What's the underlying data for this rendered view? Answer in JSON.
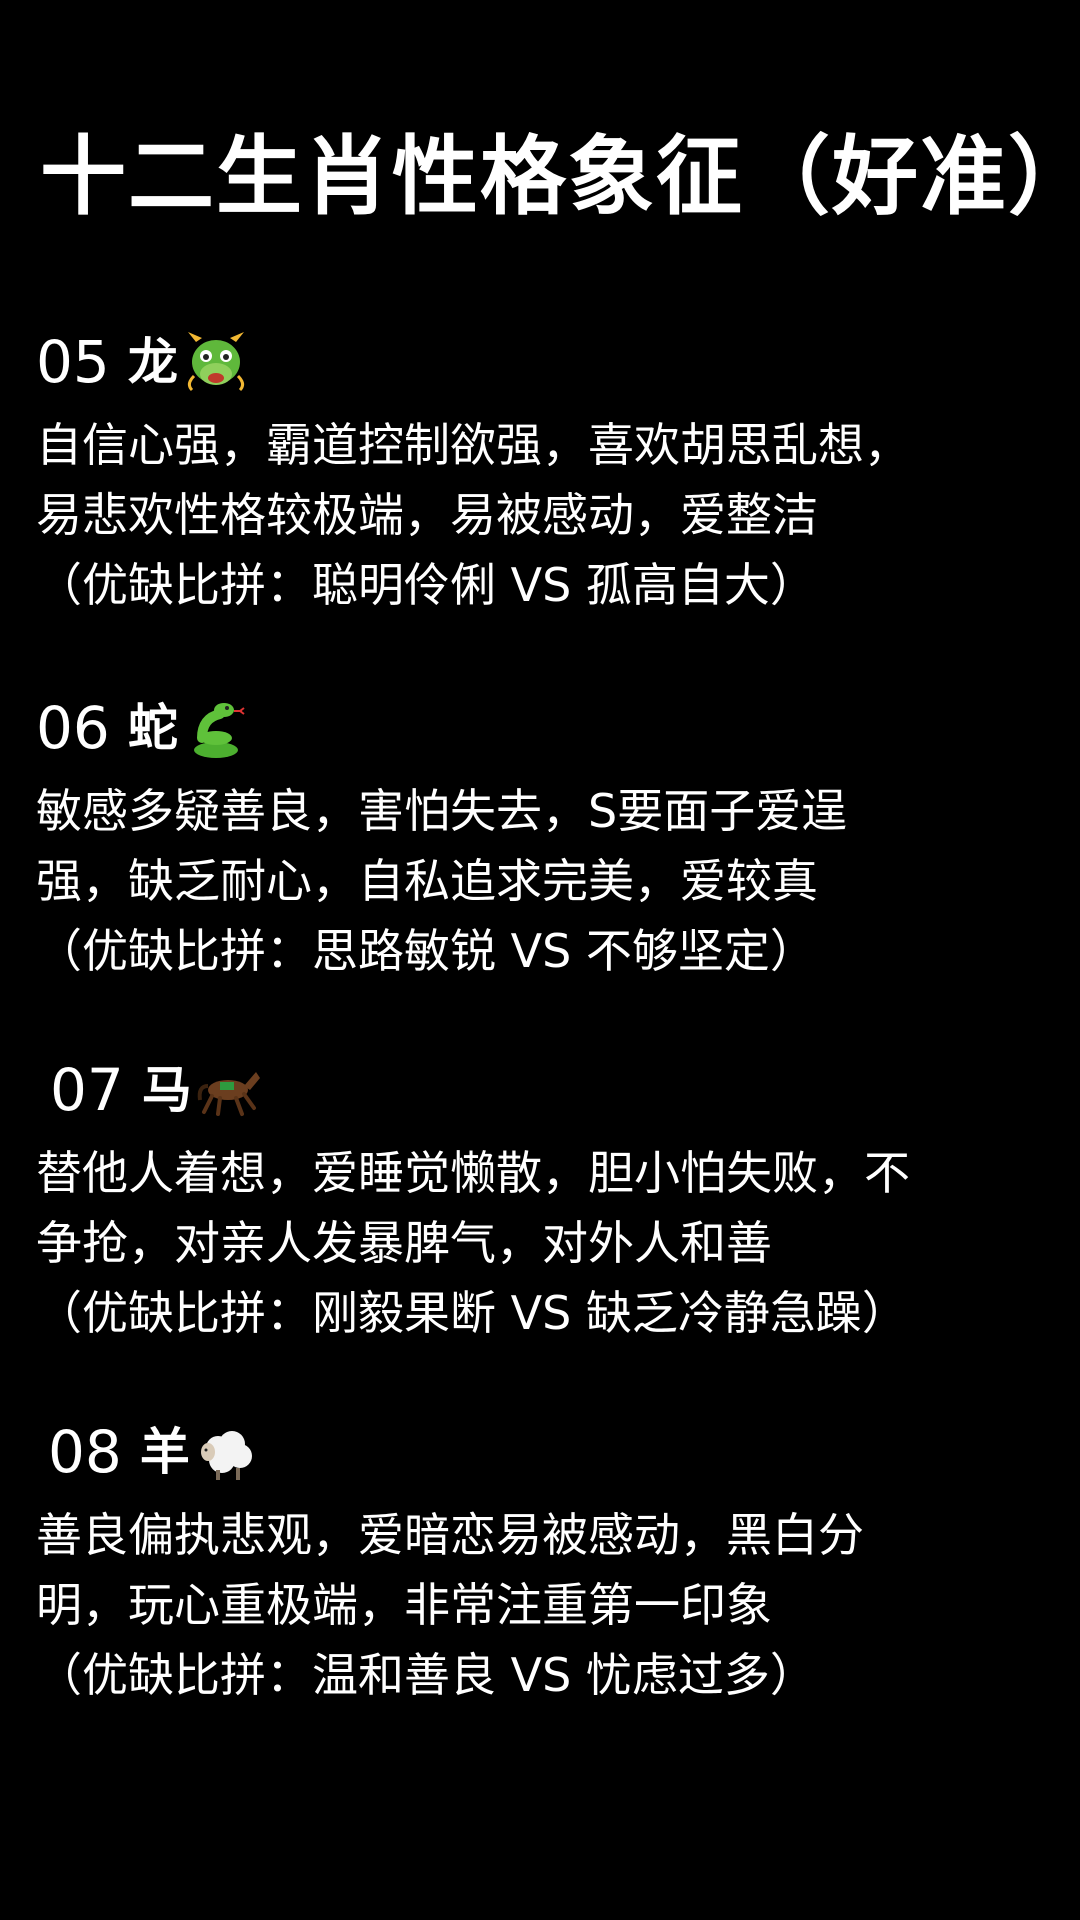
{
  "title": "十二生肖性格象征（好准）",
  "entries": [
    {
      "num": "05",
      "animal": "龙",
      "icon": "dragon-face-icon",
      "lines": [
        "自信心强，霸道控制欲强，喜欢胡思乱想，",
        "易悲欢性格较极端，易被感动，爱整洁"
      ],
      "merit": "（优缺比拼：聪明伶俐 VS 孤高自大）"
    },
    {
      "num": "06",
      "animal": "蛇",
      "icon": "snake-icon",
      "lines": [
        "敏感多疑善良，害怕失去，S要面子爱逞",
        "强，缺乏耐心，自私追求完美，爱较真"
      ],
      "merit": "（优缺比拼：思路敏锐 VS 不够坚定）"
    },
    {
      "num": "07",
      "animal": "马",
      "icon": "racehorse-icon",
      "lines": [
        "替他人着想，爱睡觉懒散，胆小怕失败，不",
        "争抢，对亲人发暴脾气，对外人和善"
      ],
      "merit": "（优缺比拼：刚毅果断 VS 缺乏冷静急躁）"
    },
    {
      "num": "08",
      "animal": "羊",
      "icon": "sheep-icon",
      "lines": [
        "善良偏执悲观，爱暗恋易被感动，黑白分",
        "明，玩心重极端，非常注重第一印象"
      ],
      "merit": "（优缺比拼：温和善良 VS 忧虑过多）"
    }
  ]
}
